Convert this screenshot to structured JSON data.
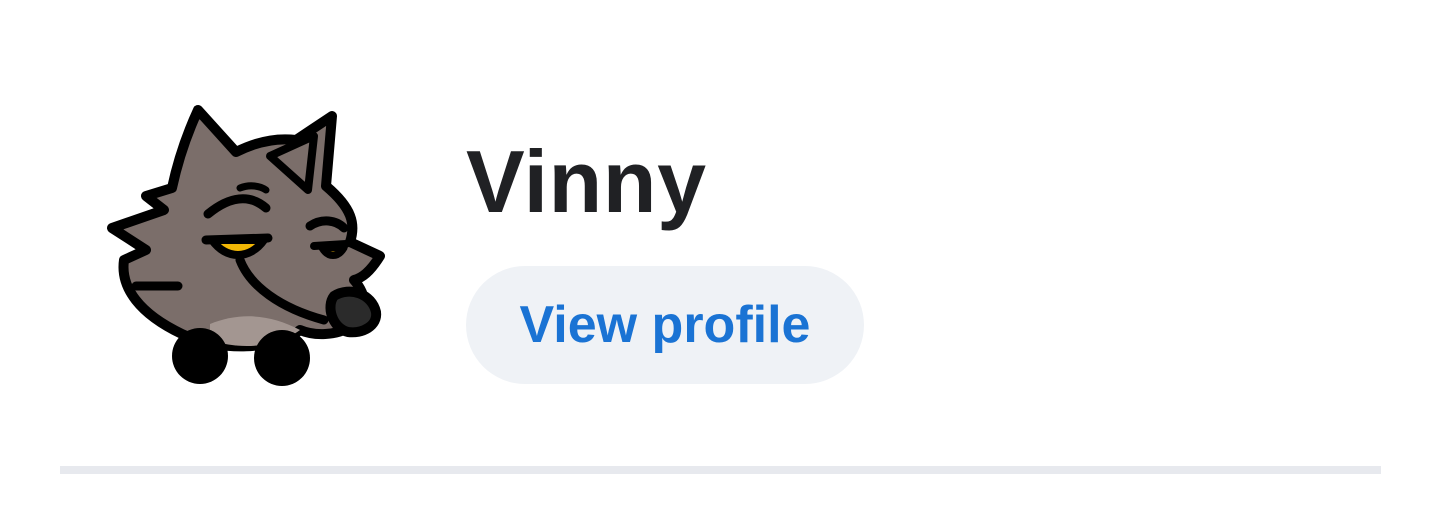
{
  "profile": {
    "avatar_icon": "wolf-avatar-icon",
    "username": "Vinny",
    "view_profile_label": "View profile"
  },
  "colors": {
    "username_text": "#202124",
    "button_text": "#1a73d4",
    "button_background": "#eff2f6",
    "divider": "#e7e9ee",
    "wolf_fur": "#7b6e6a",
    "wolf_eye": "#f2b705"
  }
}
